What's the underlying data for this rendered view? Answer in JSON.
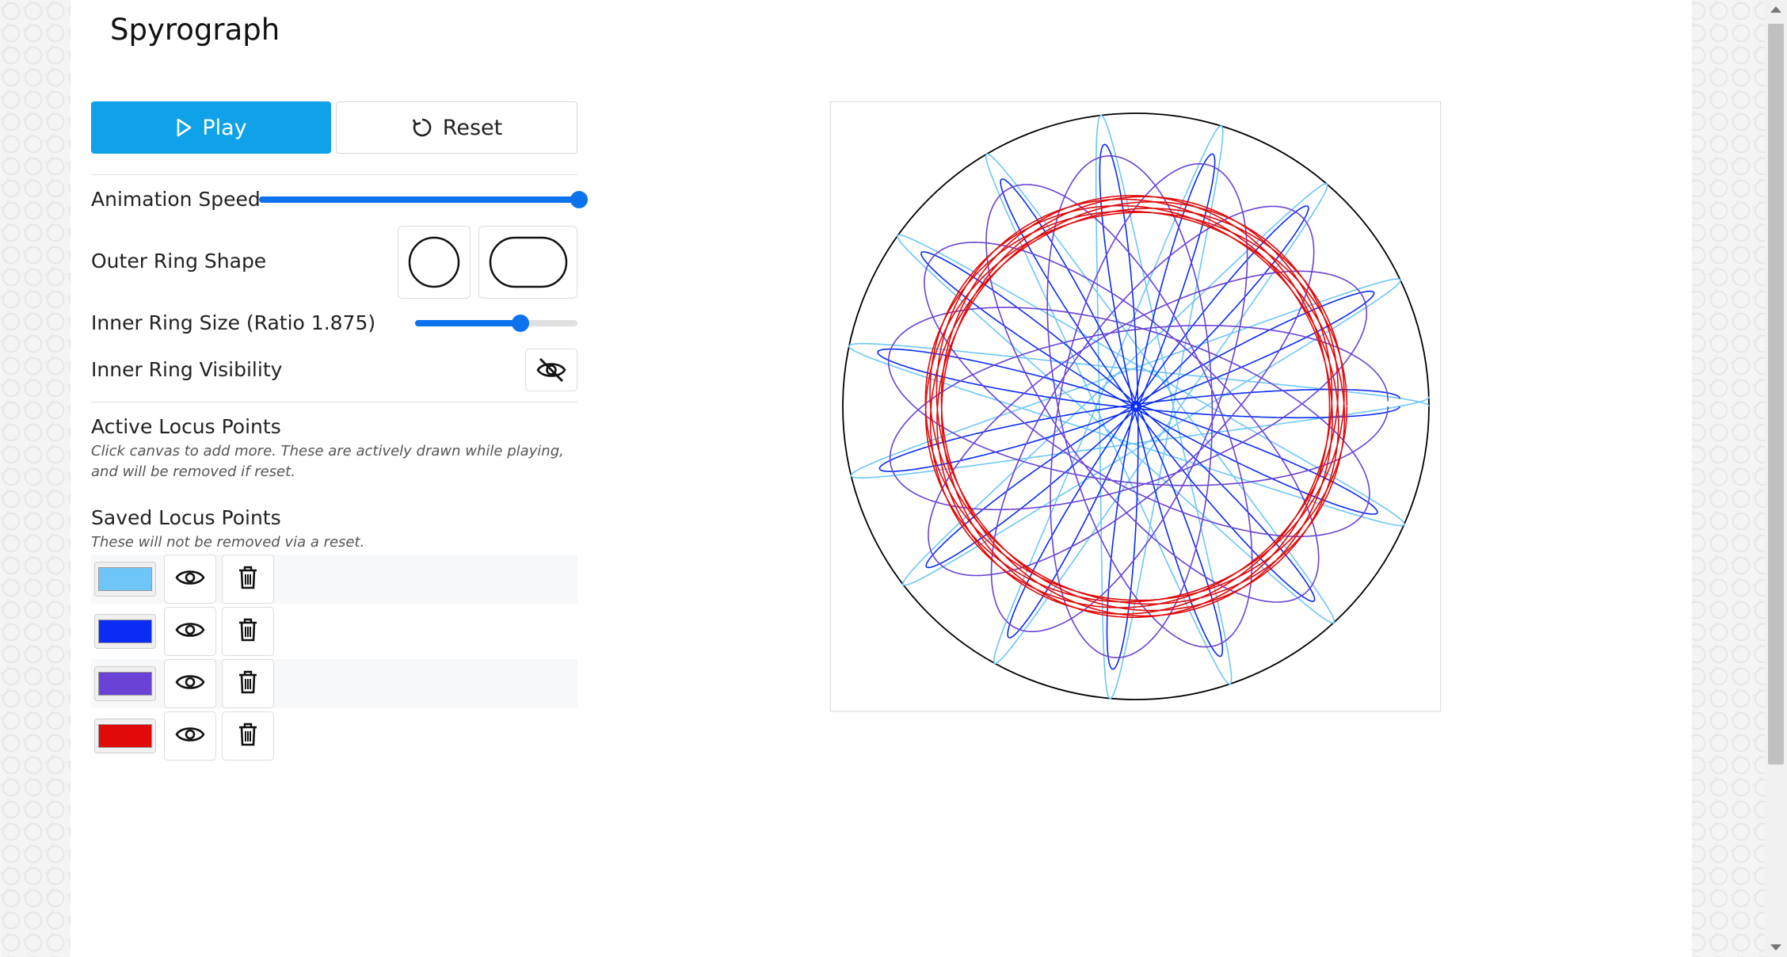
{
  "app": {
    "title": "Spyrograph"
  },
  "controls": {
    "play_label": "Play",
    "reset_label": "Reset",
    "speed_label": "Animation Speed",
    "speed_value": 1.0,
    "shape_label": "Outer Ring Shape",
    "shape_options": [
      "circle",
      "stadium"
    ],
    "inner_size_label": "Inner Ring Size (Ratio 1.875)",
    "inner_size_value": 0.65,
    "visibility_label": "Inner Ring Visibility",
    "visibility_icon": "eye-off-icon"
  },
  "active": {
    "heading": "Active Locus Points",
    "note": "Click canvas to add more. These are actively drawn while playing, and will be removed if reset."
  },
  "saved": {
    "heading": "Saved Locus Points",
    "note": "These will not be removed via a reset.",
    "items": [
      {
        "color": "#6ec6f8"
      },
      {
        "color": "#0a2cf5"
      },
      {
        "color": "#6a42d6"
      },
      {
        "color": "#e00a0a"
      }
    ]
  },
  "canvas": {
    "outer_ring_color": "#000000",
    "curves": [
      {
        "color": "#6ec6f8",
        "R": 1.0,
        "r": 0.533,
        "d": 0.6
      },
      {
        "color": "#0a2cf5",
        "R": 1.0,
        "r": 0.533,
        "d": 0.46
      },
      {
        "color": "#6a42d6",
        "R": 1.0,
        "r": 0.533,
        "d": 0.25
      },
      {
        "color": "#e00a0a",
        "R": 1.0,
        "r": 0.533,
        "d": 0.02
      }
    ]
  }
}
